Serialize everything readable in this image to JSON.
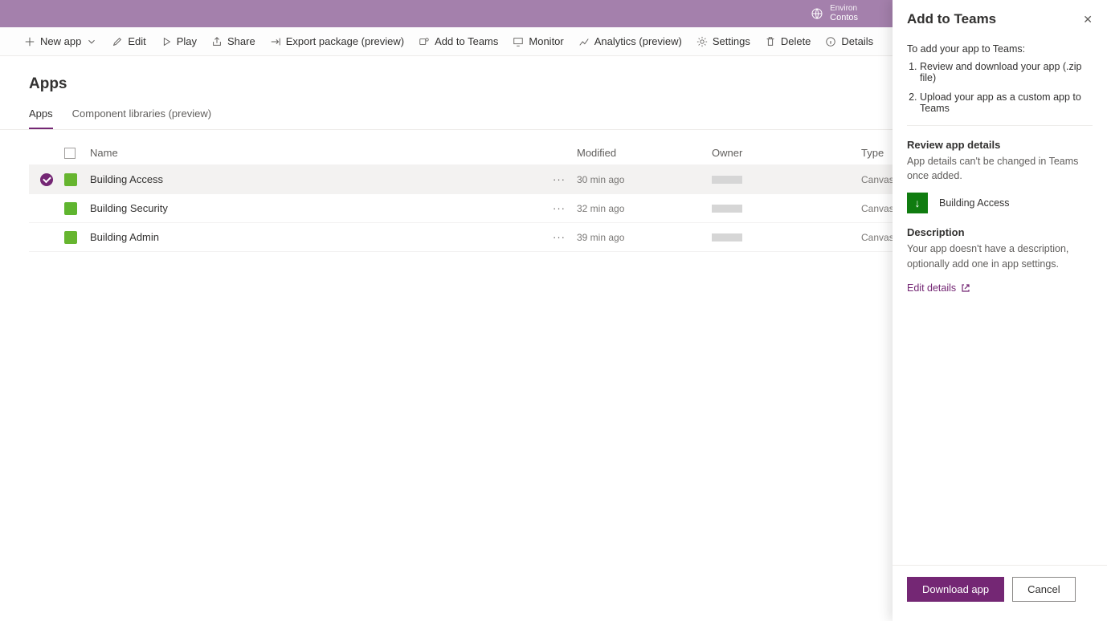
{
  "topbar": {
    "env_label": "Environ",
    "env_name": "Contos"
  },
  "toolbar": {
    "new_app": "New app",
    "edit": "Edit",
    "play": "Play",
    "share": "Share",
    "export": "Export package (preview)",
    "add_teams": "Add to Teams",
    "monitor": "Monitor",
    "analytics": "Analytics (preview)",
    "settings": "Settings",
    "delete": "Delete",
    "details": "Details"
  },
  "page": {
    "title": "Apps"
  },
  "tabs": {
    "apps": "Apps",
    "libs": "Component libraries (preview)"
  },
  "columns": {
    "name": "Name",
    "modified": "Modified",
    "owner": "Owner",
    "type": "Type"
  },
  "rows": [
    {
      "name": "Building Access",
      "modified": "30 min ago",
      "type": "Canvas",
      "selected": true,
      "icon_color": "#66b52f"
    },
    {
      "name": "Building Security",
      "modified": "32 min ago",
      "type": "Canvas",
      "selected": false,
      "icon_color": "#5fb52f"
    },
    {
      "name": "Building Admin",
      "modified": "39 min ago",
      "type": "Canvas",
      "selected": false,
      "icon_color": "#66b52f"
    }
  ],
  "panel": {
    "title": "Add to Teams",
    "intro": "To add your app to Teams:",
    "step1": "Review and download your app (.zip file)",
    "step2": "Upload your app as a custom app to Teams",
    "review_title": "Review app details",
    "review_text": "App details can't be changed in Teams once added.",
    "app_name": "Building Access",
    "desc_title": "Description",
    "desc_text": "Your app doesn't have a description, optionally add one in app settings.",
    "edit_link": "Edit details",
    "download": "Download app",
    "cancel": "Cancel"
  }
}
